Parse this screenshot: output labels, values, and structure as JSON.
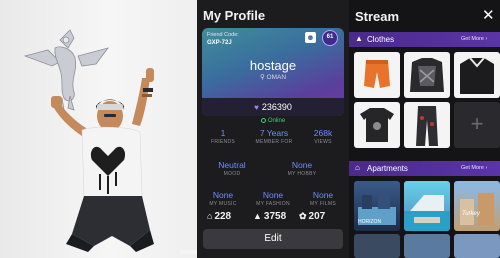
{
  "profile": {
    "title": "My Profile",
    "friend_code_label": "Friend Code:",
    "friend_code": "GXP-72J",
    "level": "61",
    "username": "hostage",
    "location": "OMAN",
    "credits": "236390",
    "status": "Online",
    "stats": [
      {
        "value": "1",
        "label": "FRIENDS"
      },
      {
        "value": "7 Years",
        "label": "MEMBER FOR"
      },
      {
        "value": "268k",
        "label": "VIEWS"
      }
    ],
    "mood": {
      "value": "Neutral",
      "label": "MOOD"
    },
    "hobby": {
      "value": "None",
      "label": "MY HOBBY"
    },
    "prefs": [
      {
        "value": "None",
        "label": "MY MUSIC"
      },
      {
        "value": "None",
        "label": "MY FASHION"
      },
      {
        "value": "None",
        "label": "MY FILMS"
      }
    ],
    "counts": [
      {
        "icon": "home-icon",
        "value": "228"
      },
      {
        "icon": "shirt-icon",
        "value": "3758"
      },
      {
        "icon": "paw-icon",
        "value": "207"
      }
    ],
    "edit_label": "Edit"
  },
  "stream": {
    "title": "Stream",
    "clothes": {
      "label": "Clothes",
      "more": "Get More"
    },
    "apartments": {
      "label": "Apartments",
      "more": "Get More"
    },
    "apartment_tiles": [
      "HORIZON",
      "",
      "Turkey"
    ]
  },
  "colors": {
    "accent_purple": "#5b34a8",
    "stat_blue": "#6e8cff",
    "online_green": "#3fd17a"
  }
}
